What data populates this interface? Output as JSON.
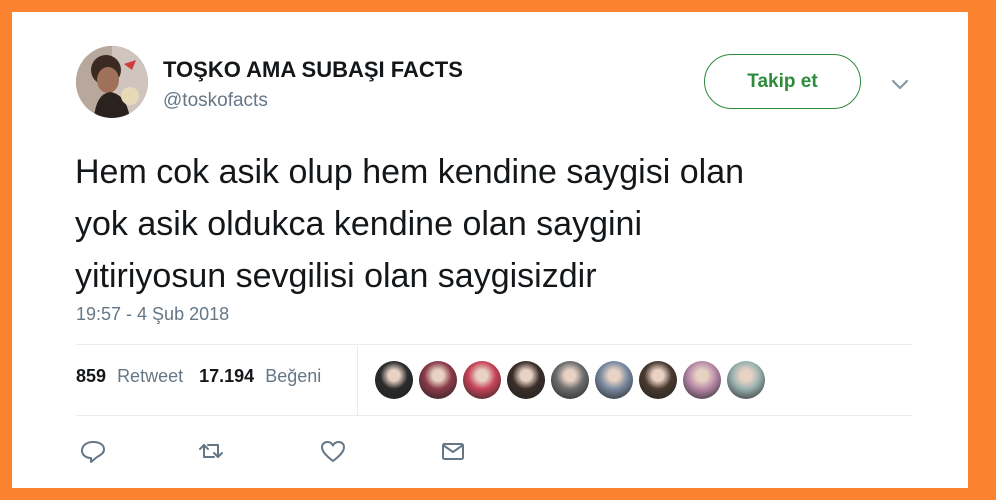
{
  "colors": {
    "page_bg": "#fb8330",
    "card_bg": "#ffffff",
    "follow_green": "#2e8b3c",
    "text_primary": "#14171a",
    "text_secondary": "#657786",
    "divider": "#e6ecf0"
  },
  "author": {
    "display_name": "TOŞKO AMA SUBAŞI FACTS",
    "handle": "@toskofacts",
    "avatar_icon": "profile-photo"
  },
  "header": {
    "follow_label": "Takip et",
    "menu_icon": "chevron-down-icon"
  },
  "tweet": {
    "text": "Hem cok asik olup hem kendine saygisi olan\nyok asik oldukca kendine olan saygini\nyitiriyosun sevgilisi olan saygisizdir",
    "timestamp": "19:57 - 4 Şub 2018"
  },
  "stats": {
    "retweets_count": "859",
    "retweets_label": "Retweet",
    "likes_count": "17.194",
    "likes_label": "Beğeni"
  },
  "likers": [
    {
      "name": "liker-avatar-1",
      "color": "#2b2b2b"
    },
    {
      "name": "liker-avatar-2",
      "color": "#8a3a4a"
    },
    {
      "name": "liker-avatar-3",
      "color": "#c7445a"
    },
    {
      "name": "liker-avatar-4",
      "color": "#3a2e2a"
    },
    {
      "name": "liker-avatar-5",
      "color": "#6d6d6d"
    },
    {
      "name": "liker-avatar-6",
      "color": "#7a8aa0"
    },
    {
      "name": "liker-avatar-7",
      "color": "#4a3a30"
    },
    {
      "name": "liker-avatar-8",
      "color": "#b88aa8"
    },
    {
      "name": "liker-avatar-9",
      "color": "#9ab3b0"
    }
  ],
  "actions": [
    {
      "name": "reply-icon"
    },
    {
      "name": "retweet-icon"
    },
    {
      "name": "like-icon"
    },
    {
      "name": "direct-message-icon"
    }
  ]
}
